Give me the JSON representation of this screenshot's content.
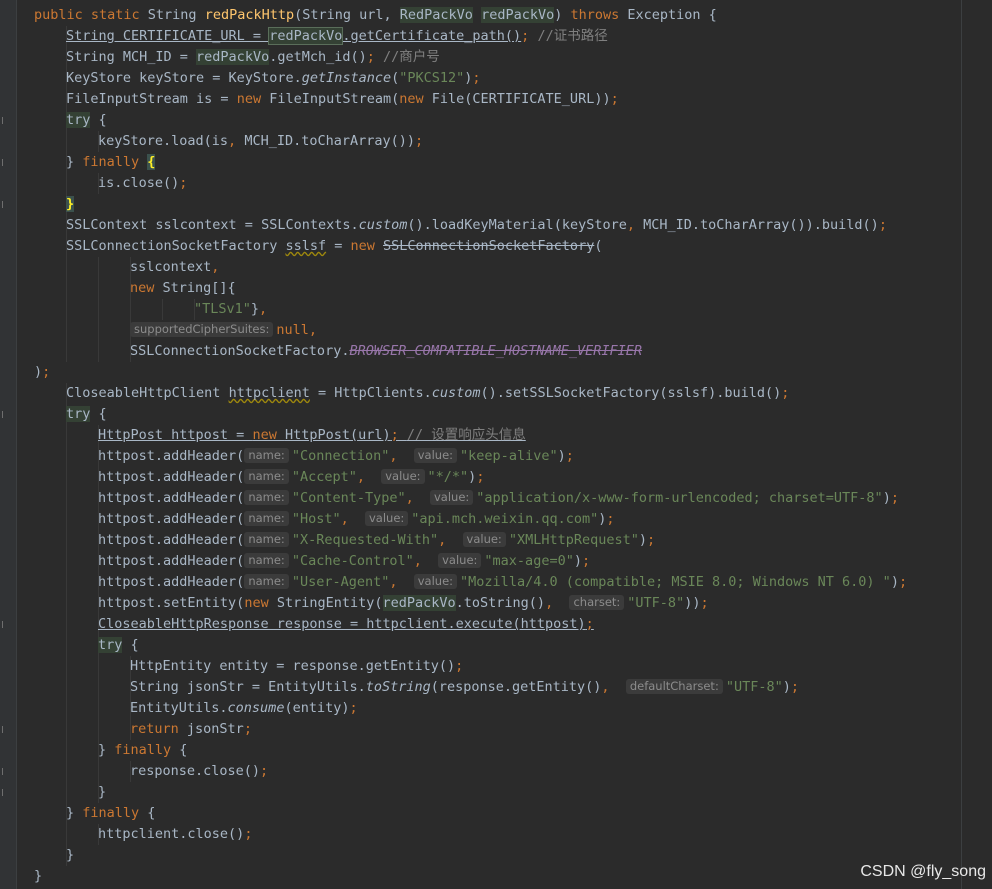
{
  "watermark": "CSDN @fly_song",
  "colors": {
    "background": "#2b2b2b",
    "keyword": "#cc7832",
    "string": "#6a8759",
    "comment": "#808080",
    "method_declaration": "#ffc66d",
    "static_field": "#9876aa",
    "default_text": "#a9b7c6",
    "param_hint_bg": "#3b3b3b"
  },
  "code_lines": [
    {
      "indent": 1,
      "tokens": [
        {
          "t": "public static ",
          "c": "kw"
        },
        {
          "t": "String "
        },
        {
          "t": "redPackHttp",
          "c": "fn"
        },
        {
          "t": "(String url, "
        },
        {
          "t": "RedPackVo",
          "c": "hl"
        },
        {
          "t": " "
        },
        {
          "t": "redPackVo",
          "c": "hl"
        },
        {
          "t": ") "
        },
        {
          "t": "throws ",
          "c": "kw"
        },
        {
          "t": "Exception {"
        }
      ]
    },
    {
      "indent": 2,
      "tokens": [
        {
          "t": "String CERTIFICATE_URL = ",
          "c": "uline"
        },
        {
          "t": "redPackVo",
          "c": "hl box"
        },
        {
          "t": ".getCertificate_path()",
          "c": "uline"
        },
        {
          "t": "; ",
          "c": "kw"
        },
        {
          "t": "//证书路径",
          "c": "cm"
        }
      ]
    },
    {
      "indent": 2,
      "tokens": [
        {
          "t": "String MCH_ID = "
        },
        {
          "t": "redPackVo",
          "c": "hl"
        },
        {
          "t": ".getMch_id()"
        },
        {
          "t": "; ",
          "c": "kw"
        },
        {
          "t": "//商户号",
          "c": "cm"
        }
      ]
    },
    {
      "indent": 2,
      "tokens": [
        {
          "t": "KeyStore keyStore = KeyStore."
        },
        {
          "t": "getInstance",
          "c": "it"
        },
        {
          "t": "("
        },
        {
          "t": "\"PKCS12\"",
          "c": "str"
        },
        {
          "t": ")"
        },
        {
          "t": ";",
          "c": "kw"
        }
      ]
    },
    {
      "indent": 2,
      "tokens": [
        {
          "t": "FileInputStream is = "
        },
        {
          "t": "new ",
          "c": "kw"
        },
        {
          "t": "FileInputStream("
        },
        {
          "t": "new ",
          "c": "kw"
        },
        {
          "t": "File(CERTIFICATE_URL))"
        },
        {
          "t": ";",
          "c": "kw"
        }
      ]
    },
    {
      "indent": 2,
      "tokens": [
        {
          "t": "try",
          "c": "kw hl"
        },
        {
          "t": " {"
        }
      ]
    },
    {
      "indent": 3,
      "tokens": [
        {
          "t": "keyStore.load(is"
        },
        {
          "t": ", ",
          "c": "kw"
        },
        {
          "t": "MCH_ID.toCharArray())"
        },
        {
          "t": ";",
          "c": "kw"
        }
      ]
    },
    {
      "indent": 2,
      "current": true,
      "tokens": [
        {
          "t": "} "
        },
        {
          "t": "finally ",
          "c": "kw"
        },
        {
          "t": "{",
          "c": "brace"
        }
      ]
    },
    {
      "indent": 3,
      "tokens": [
        {
          "t": "is.close()"
        },
        {
          "t": ";",
          "c": "kw"
        }
      ]
    },
    {
      "indent": 2,
      "tokens": [
        {
          "t": "}",
          "c": "brace"
        }
      ]
    },
    {
      "indent": 2,
      "tokens": [
        {
          "t": "SSLContext sslcontext = SSLContexts."
        },
        {
          "t": "custom",
          "c": "it"
        },
        {
          "t": "().loadKeyMaterial(keyStore"
        },
        {
          "t": ", ",
          "c": "kw"
        },
        {
          "t": "MCH_ID.toCharArray()).build()"
        },
        {
          "t": ";",
          "c": "kw"
        }
      ]
    },
    {
      "indent": 2,
      "tokens": [
        {
          "t": "SSLConnectionSocketFactory "
        },
        {
          "t": "sslsf",
          "c": "wavy"
        },
        {
          "t": " = "
        },
        {
          "t": "new ",
          "c": "kw"
        },
        {
          "t": "SSLConnectionSocketFactory",
          "c": "strike"
        },
        {
          "t": "("
        }
      ]
    },
    {
      "indent": 4,
      "tokens": [
        {
          "t": "sslcontext"
        },
        {
          "t": ",",
          "c": "kw"
        }
      ]
    },
    {
      "indent": 4,
      "tokens": [
        {
          "t": "new ",
          "c": "kw"
        },
        {
          "t": "String[]{"
        }
      ]
    },
    {
      "indent": 6,
      "tokens": [
        {
          "t": "\"TLSv1\"",
          "c": "str"
        },
        {
          "t": "}"
        },
        {
          "t": ",",
          "c": "kw"
        }
      ]
    },
    {
      "indent": 4,
      "tokens": [
        {
          "hint": "supportedCipherSuites:"
        },
        {
          "t": "null",
          "c": "kw"
        },
        {
          "t": ",",
          "c": "kw"
        }
      ]
    },
    {
      "indent": 4,
      "tokens": [
        {
          "t": "SSLConnectionSocketFactory."
        },
        {
          "t": "BROWSER_COMPATIBLE_HOSTNAME_VERIFIER",
          "c": "field strike"
        }
      ]
    },
    {
      "indent": 1,
      "tokens": [
        {
          "t": ")"
        },
        {
          "t": ";",
          "c": "kw"
        }
      ]
    },
    {
      "indent": 2,
      "tokens": [
        {
          "t": "CloseableHttpClient "
        },
        {
          "t": "httpclient",
          "c": "wavy"
        },
        {
          "t": " = HttpClients."
        },
        {
          "t": "custom",
          "c": "it"
        },
        {
          "t": "().setSSLSocketFactory(sslsf).build()"
        },
        {
          "t": ";",
          "c": "kw"
        }
      ]
    },
    {
      "indent": 2,
      "tokens": [
        {
          "t": "try",
          "c": "kw hl"
        },
        {
          "t": " {"
        }
      ]
    },
    {
      "indent": 3,
      "tokens": [
        {
          "t": "HttpPost httpost = ",
          "c": "uline"
        },
        {
          "t": "new ",
          "c": "kw uline"
        },
        {
          "t": "HttpPost(url)",
          "c": "uline"
        },
        {
          "t": "; ",
          "c": "kw uline"
        },
        {
          "t": "// 设置响应头信息",
          "c": "cm uline"
        }
      ]
    },
    {
      "indent": 3,
      "tokens": [
        {
          "t": "httpost.addHeader("
        },
        {
          "hint": "name:"
        },
        {
          "t": "\"Connection\"",
          "c": "str"
        },
        {
          "t": ",  ",
          "c": "kw"
        },
        {
          "hint": "value:"
        },
        {
          "t": "\"keep-alive\"",
          "c": "str"
        },
        {
          "t": ")"
        },
        {
          "t": ";",
          "c": "kw"
        }
      ]
    },
    {
      "indent": 3,
      "tokens": [
        {
          "t": "httpost.addHeader("
        },
        {
          "hint": "name:"
        },
        {
          "t": "\"Accept\"",
          "c": "str"
        },
        {
          "t": ",  ",
          "c": "kw"
        },
        {
          "hint": "value:"
        },
        {
          "t": "\"*/*\"",
          "c": "str"
        },
        {
          "t": ")"
        },
        {
          "t": ";",
          "c": "kw"
        }
      ]
    },
    {
      "indent": 3,
      "tokens": [
        {
          "t": "httpost.addHeader("
        },
        {
          "hint": "name:"
        },
        {
          "t": "\"Content-Type\"",
          "c": "str"
        },
        {
          "t": ",  ",
          "c": "kw"
        },
        {
          "hint": "value:"
        },
        {
          "t": "\"application/x-www-form-urlencoded; charset=UTF-8\"",
          "c": "str"
        },
        {
          "t": ")"
        },
        {
          "t": ";",
          "c": "kw"
        }
      ]
    },
    {
      "indent": 3,
      "tokens": [
        {
          "t": "httpost.addHeader("
        },
        {
          "hint": "name:"
        },
        {
          "t": "\"Host\"",
          "c": "str"
        },
        {
          "t": ",  ",
          "c": "kw"
        },
        {
          "hint": "value:"
        },
        {
          "t": "\"api.mch.weixin.qq.com\"",
          "c": "str"
        },
        {
          "t": ")"
        },
        {
          "t": ";",
          "c": "kw"
        }
      ]
    },
    {
      "indent": 3,
      "tokens": [
        {
          "t": "httpost.addHeader("
        },
        {
          "hint": "name:"
        },
        {
          "t": "\"X-Requested-With\"",
          "c": "str"
        },
        {
          "t": ",  ",
          "c": "kw"
        },
        {
          "hint": "value:"
        },
        {
          "t": "\"XMLHttpRequest\"",
          "c": "str"
        },
        {
          "t": ")"
        },
        {
          "t": ";",
          "c": "kw"
        }
      ]
    },
    {
      "indent": 3,
      "tokens": [
        {
          "t": "httpost.addHeader("
        },
        {
          "hint": "name:"
        },
        {
          "t": "\"Cache-Control\"",
          "c": "str"
        },
        {
          "t": ",  ",
          "c": "kw"
        },
        {
          "hint": "value:"
        },
        {
          "t": "\"max-age=0\"",
          "c": "str"
        },
        {
          "t": ")"
        },
        {
          "t": ";",
          "c": "kw"
        }
      ]
    },
    {
      "indent": 3,
      "tokens": [
        {
          "t": "httpost.addHeader("
        },
        {
          "hint": "name:"
        },
        {
          "t": "\"User-Agent\"",
          "c": "str"
        },
        {
          "t": ",  ",
          "c": "kw"
        },
        {
          "hint": "value:"
        },
        {
          "t": "\"Mozilla/4.0 (compatible; MSIE 8.0; Windows NT 6.0) \"",
          "c": "str"
        },
        {
          "t": ")"
        },
        {
          "t": ";",
          "c": "kw"
        }
      ]
    },
    {
      "indent": 3,
      "tokens": [
        {
          "t": "httpost.setEntity("
        },
        {
          "t": "new ",
          "c": "kw"
        },
        {
          "t": "StringEntity("
        },
        {
          "t": "redPackVo",
          "c": "hl"
        },
        {
          "t": ".toString()"
        },
        {
          "t": ",  ",
          "c": "kw"
        },
        {
          "hint": "charset:"
        },
        {
          "t": "\"UTF-8\"",
          "c": "str"
        },
        {
          "t": "))"
        },
        {
          "t": ";",
          "c": "kw"
        }
      ]
    },
    {
      "indent": 3,
      "tokens": [
        {
          "t": "CloseableHttpResponse response = httpclient.execute(httpost)",
          "c": "uline"
        },
        {
          "t": ";",
          "c": "kw uline"
        }
      ]
    },
    {
      "indent": 3,
      "tokens": [
        {
          "t": "try",
          "c": "kw hl"
        },
        {
          "t": " {"
        }
      ]
    },
    {
      "indent": 4,
      "tokens": [
        {
          "t": "HttpEntity entity = response.getEntity()"
        },
        {
          "t": ";",
          "c": "kw"
        }
      ]
    },
    {
      "indent": 4,
      "tokens": [
        {
          "t": "String jsonStr = EntityUtils."
        },
        {
          "t": "toString",
          "c": "it"
        },
        {
          "t": "(response.getEntity()"
        },
        {
          "t": ",  ",
          "c": "kw"
        },
        {
          "hint": "defaultCharset:"
        },
        {
          "t": "\"UTF-8\"",
          "c": "str"
        },
        {
          "t": ")"
        },
        {
          "t": ";",
          "c": "kw"
        }
      ]
    },
    {
      "indent": 4,
      "tokens": [
        {
          "t": "EntityUtils."
        },
        {
          "t": "consume",
          "c": "it"
        },
        {
          "t": "(entity)"
        },
        {
          "t": ";",
          "c": "kw"
        }
      ]
    },
    {
      "indent": 4,
      "tokens": [
        {
          "t": "return ",
          "c": "kw"
        },
        {
          "t": "jsonStr"
        },
        {
          "t": ";",
          "c": "kw"
        }
      ]
    },
    {
      "indent": 3,
      "tokens": [
        {
          "t": "} "
        },
        {
          "t": "finally ",
          "c": "kw"
        },
        {
          "t": "{"
        }
      ]
    },
    {
      "indent": 4,
      "tokens": [
        {
          "t": "response.close()"
        },
        {
          "t": ";",
          "c": "kw"
        }
      ]
    },
    {
      "indent": 3,
      "tokens": [
        {
          "t": "}"
        }
      ]
    },
    {
      "indent": 2,
      "tokens": [
        {
          "t": "} "
        },
        {
          "t": "finally ",
          "c": "kw"
        },
        {
          "t": "{"
        }
      ]
    },
    {
      "indent": 3,
      "tokens": [
        {
          "t": "httpclient.close()"
        },
        {
          "t": ";",
          "c": "kw"
        }
      ]
    },
    {
      "indent": 2,
      "tokens": [
        {
          "t": "}"
        }
      ]
    },
    {
      "indent": 1,
      "tokens": [
        {
          "t": "}"
        }
      ]
    }
  ]
}
